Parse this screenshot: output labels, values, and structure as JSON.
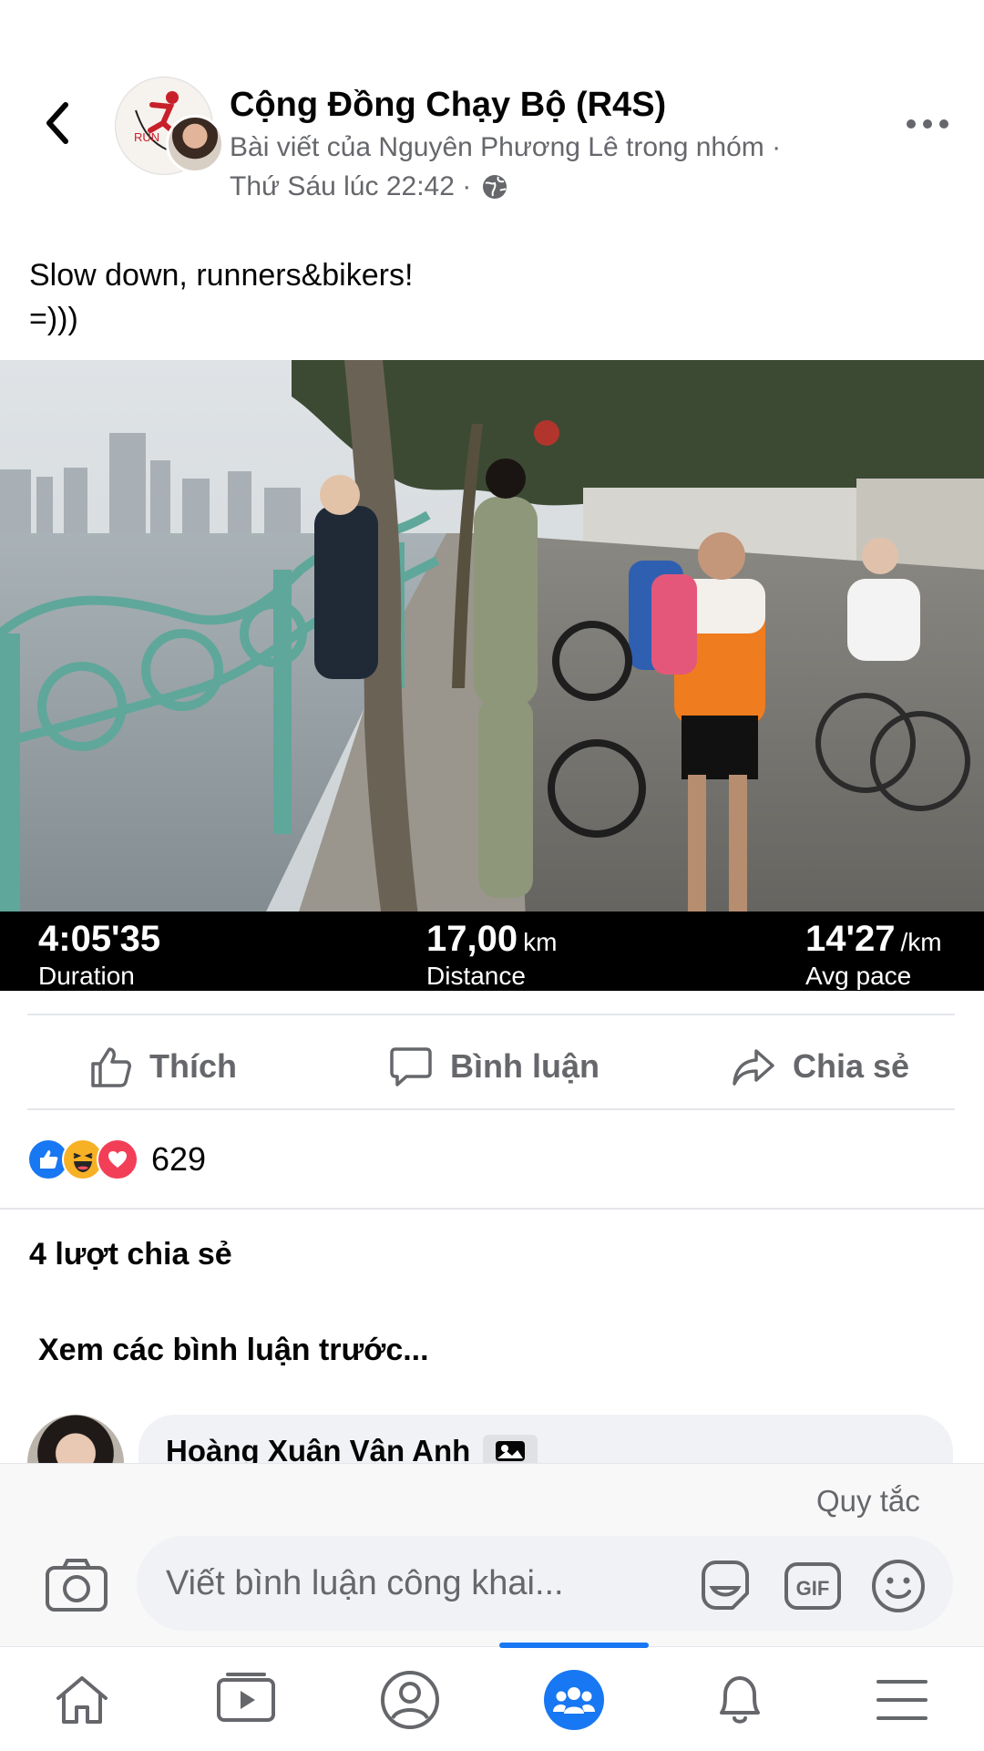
{
  "header": {
    "group_name": "Cộng Đồng Chạy Bộ (R4S)",
    "byline": "Bài viết của Nguyên Phương Lê trong nhóm ·",
    "timestamp": "Thứ Sáu lúc 22:42 ·",
    "avatar_logo_text": "RUN"
  },
  "post": {
    "text": "Slow down, runners&bikers!\n=)))"
  },
  "run_stats": [
    {
      "value": "4:05'35",
      "unit": "",
      "label": "Duration"
    },
    {
      "value": "17,00",
      "unit": "km",
      "label": "Distance"
    },
    {
      "value": "14'27",
      "unit": "/km",
      "label": "Avg pace"
    }
  ],
  "actions": {
    "like": "Thích",
    "comment": "Bình luận",
    "share": "Chia sẻ"
  },
  "reactions": {
    "count": "629",
    "types": [
      "like",
      "haha",
      "love"
    ]
  },
  "shares_text": "4 lượt chia sẻ",
  "previous_comments": "Xem các bình luận trước...",
  "comment_preview": {
    "author": "Hoàng Xuân Vân Anh"
  },
  "composer": {
    "rules": "Quy tắc",
    "placeholder": "Viết bình luận công khai...",
    "gif_label": "GIF"
  },
  "nav": {
    "items": [
      "home",
      "watch",
      "profile",
      "groups",
      "notifications",
      "menu"
    ],
    "active": "groups"
  },
  "colors": {
    "accent": "#1877f2",
    "secondary_text": "#65676b",
    "like_blue": "#1877f2",
    "love_red": "#f33e58",
    "haha_yellow": "#f7b125"
  }
}
